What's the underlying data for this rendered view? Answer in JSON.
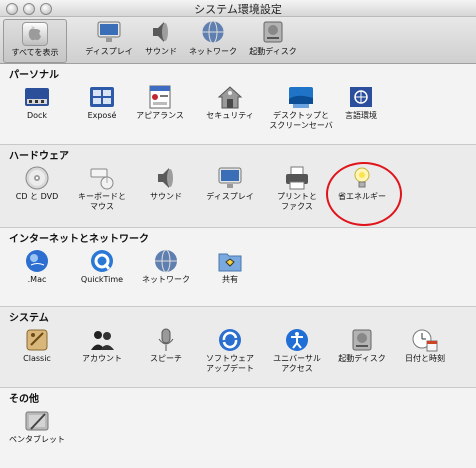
{
  "window": {
    "title": "システム環境設定"
  },
  "toolbar": {
    "items": [
      {
        "label": "すべてを表示",
        "icon": "apple-logo-icon"
      },
      {
        "label": "ディスプレイ",
        "icon": "display-icon"
      },
      {
        "label": "サウンド",
        "icon": "speaker-icon"
      },
      {
        "label": "ネットワーク",
        "icon": "network-globe-icon"
      },
      {
        "label": "起動ディスク",
        "icon": "hard-disk-icon"
      }
    ]
  },
  "sections": [
    {
      "title": "パーソナル",
      "items": [
        {
          "label": "Dock",
          "icon": "dock-icon"
        },
        {
          "label": "Exposé",
          "icon": "expose-icon"
        },
        {
          "label": "アピアランス",
          "icon": "appearance-icon"
        },
        {
          "label": "セキュリティ",
          "icon": "security-house-icon"
        },
        {
          "label": "デスクトップと\nスクリーンセーバ",
          "icon": "desktop-icon"
        },
        {
          "label": "言語環境",
          "icon": "international-flag-icon"
        }
      ]
    },
    {
      "title": "ハードウェア",
      "items": [
        {
          "label": "CD と DVD",
          "icon": "cd-dvd-icon"
        },
        {
          "label": "キーボードと\nマウス",
          "icon": "keyboard-mouse-icon"
        },
        {
          "label": "サウンド",
          "icon": "speaker-icon"
        },
        {
          "label": "ディスプレイ",
          "icon": "display-icon"
        },
        {
          "label": "プリントと\nファクス",
          "icon": "printer-icon"
        },
        {
          "label": "省エネルギー",
          "icon": "lightbulb-icon"
        }
      ]
    },
    {
      "title": "インターネットとネットワーク",
      "items": [
        {
          "label": ".Mac",
          "icon": "dotmac-globe-icon"
        },
        {
          "label": "QuickTime",
          "icon": "quicktime-icon"
        },
        {
          "label": "ネットワーク",
          "icon": "network-globe-icon"
        },
        {
          "label": "共有",
          "icon": "sharing-folder-icon"
        }
      ]
    },
    {
      "title": "システム",
      "items": [
        {
          "label": "Classic",
          "icon": "classic-icon"
        },
        {
          "label": "アカウント",
          "icon": "accounts-icon"
        },
        {
          "label": "スピーチ",
          "icon": "microphone-icon"
        },
        {
          "label": "ソフトウェア\nアップデート",
          "icon": "software-update-icon"
        },
        {
          "label": "ユニバーサル\nアクセス",
          "icon": "universal-access-icon"
        },
        {
          "label": "起動ディスク",
          "icon": "hard-disk-icon"
        },
        {
          "label": "日付と時刻",
          "icon": "date-time-icon"
        }
      ]
    },
    {
      "title": "その他",
      "items": [
        {
          "label": "ペンタブレット",
          "icon": "pen-tablet-icon"
        }
      ]
    }
  ],
  "annotation": {
    "highlighted_item": "省エネルギー",
    "color": "#e0141b"
  }
}
